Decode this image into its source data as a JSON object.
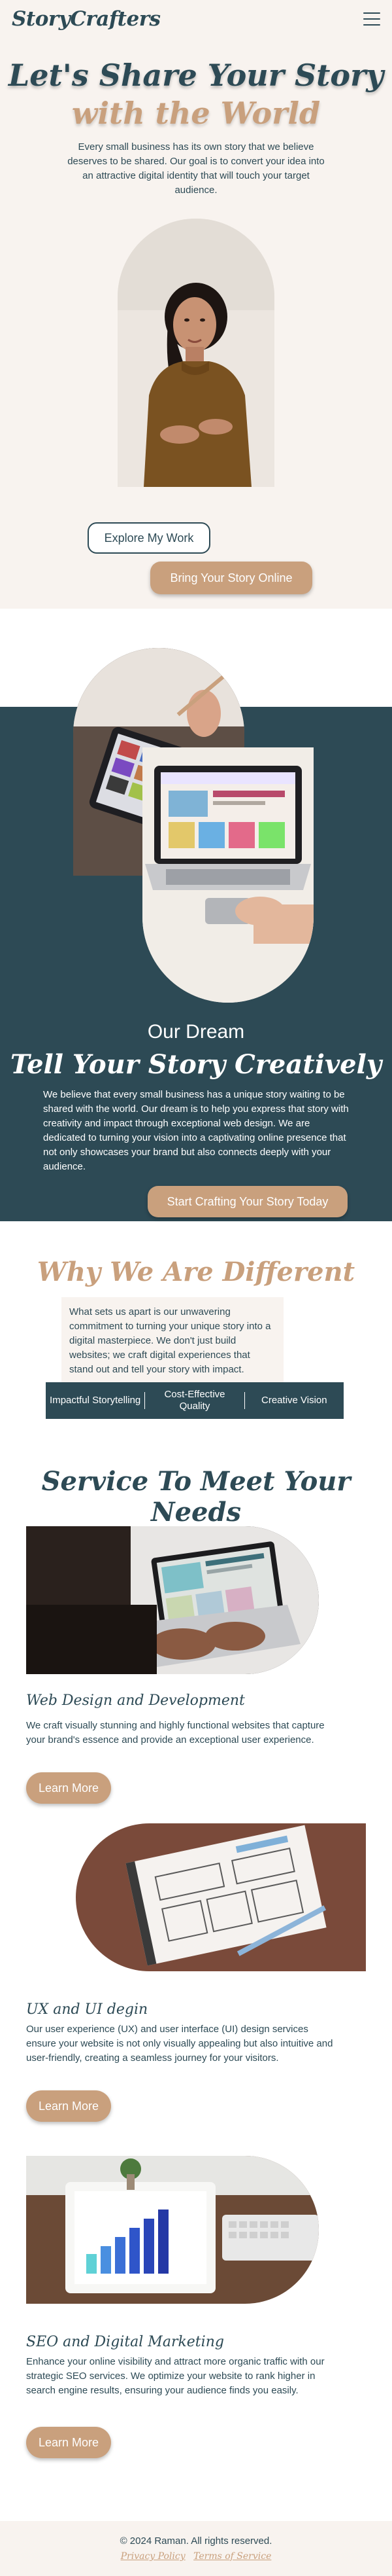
{
  "brand": {
    "logo": "StoryCrafters"
  },
  "colors": {
    "primary": "#2d4a55",
    "accent": "#c9a07d",
    "background": "#f8f3ef"
  },
  "icons": {
    "menu": "hamburger-menu-icon"
  },
  "hero": {
    "title_line1": "Let's Share Your Story",
    "title_line2": "with the World",
    "description": "Every small business has its own story that we believe deserves to be shared. Our goal is to convert your idea into an attractive digital identity that will touch your target audience.",
    "explore_button": "Explore My Work",
    "share_button": "Bring Your Story Online"
  },
  "dream": {
    "subtitle": "Our Dream",
    "title": "Tell Your Story Creatively",
    "description": "We believe that every small business has a unique story waiting to be shared with the world. Our dream is to help you express that story with creativity and impact through exceptional web design. We are dedicated to turning your vision into a captivating online presence that not only showcases your brand but also connects deeply with your audience.",
    "button": "Start Crafting Your Story Today"
  },
  "different": {
    "title": "Why We Are Different",
    "description": "What sets us apart is our unwavering commitment to turning your unique story into a digital masterpiece. We don't just build websites; we craft digital experiences that stand out and tell your story with impact.",
    "values": [
      "Impactful Storytelling",
      "Cost-Effective Quality",
      "Creative Vision"
    ]
  },
  "services": {
    "title": "Service To Meet Your Needs",
    "learn_more": "Learn More",
    "items": [
      {
        "name": "Web Design and Development",
        "description": "We craft visually stunning and highly functional websites that capture your brand's essence and provide an exceptional user experience."
      },
      {
        "name": "UX and UI degin",
        "description": "Our user experience (UX) and user interface (UI) design services ensure your website is not only visually appealing but also intuitive and user-friendly, creating a seamless journey for your visitors."
      },
      {
        "name": "SEO and Digital Marketing",
        "description": "Enhance your online visibility and attract more organic traffic with our strategic SEO services. We optimize your website to rank higher in search engine results, ensuring your audience finds you easily."
      }
    ]
  },
  "footer": {
    "copyright": "© 2024 Raman. All rights reserved.",
    "privacy": "Privacy Policy",
    "terms": "Terms of Service"
  }
}
